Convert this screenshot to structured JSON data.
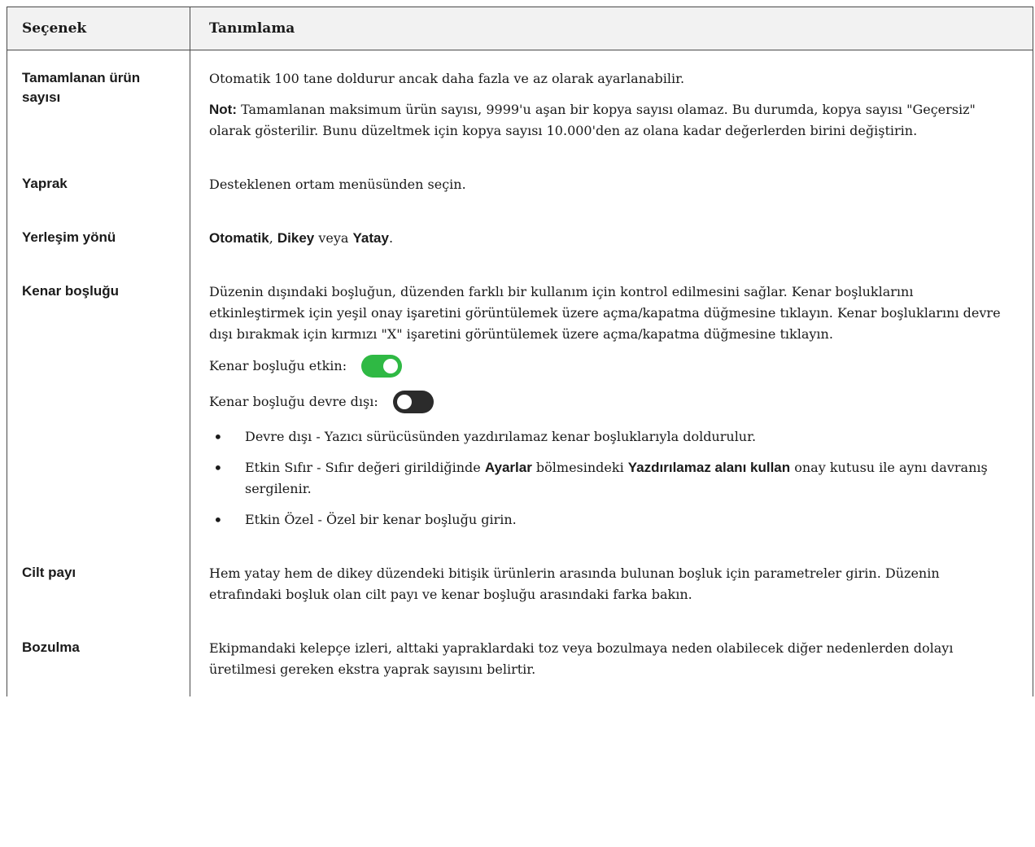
{
  "header": {
    "col1": "Seçenek",
    "col2": "Tanımlama"
  },
  "colors": {
    "toggle_on": "#2fb944",
    "toggle_off": "#2b2b2b",
    "header_bg": "#f2f2f2"
  },
  "rows": {
    "completed": {
      "label": "Tamamlanan ürün sayısı",
      "text": "Otomatik 100 tane doldurur ancak daha fazla ve az olarak ayarlanabilir.",
      "note_label": "Not:",
      "note_text": " Tamamlanan maksimum ürün sayısı, 9999'u aşan bir kopya sayısı olamaz. Bu durumda, kopya sayısı \"Geçersiz\" olarak gösterilir. Bunu düzeltmek için kopya sayısı 10.000'den az olana kadar değerlerden birini değiştirin."
    },
    "sheet": {
      "label": "Yaprak",
      "text": "Desteklenen ortam menüsünden seçin."
    },
    "orientation": {
      "label": "Yerleşim yönü",
      "opt1": "Otomatik",
      "sep1": ", ",
      "opt2": "Dikey",
      "sep2": " veya ",
      "opt3": "Yatay",
      "end": "."
    },
    "margin": {
      "label": "Kenar boşluğu",
      "text": "Düzenin dışındaki boşluğun, düzenden farklı bir kullanım için kontrol edilmesini sağlar. Kenar boşluklarını etkinleştirmek için yeşil onay işaretini görüntülemek üzere açma/kapatma düğmesine tıklayın. Kenar boşluklarını devre dışı bırakmak için kırmızı \"X\" işaretini görüntülemek üzere açma/kapatma düğmesine tıklayın.",
      "enabled_label": "Kenar boşluğu etkin:",
      "disabled_label": "Kenar boşluğu devre dışı:",
      "bullet1": "Devre dışı - Yazıcı sürücüsünden yazdırılamaz kenar boşluklarıyla doldurulur.",
      "bullet2_a": "Etkin Sıfır - Sıfır değeri girildiğinde ",
      "bullet2_b": "Ayarlar",
      "bullet2_c": " bölmesindeki ",
      "bullet2_d": "Yazdırılamaz alanı kullan",
      "bullet2_e": " onay kutusu ile aynı davranış sergilenir.",
      "bullet3": "Etkin Özel - Özel bir kenar boşluğu girin."
    },
    "gutter": {
      "label": "Cilt payı",
      "text": "Hem yatay hem de dikey düzendeki bitişik ürünlerin arasında bulunan boşluk için parametreler girin. Düzenin etrafındaki boşluk olan cilt payı ve kenar boşluğu arasındaki farka bakın."
    },
    "spoilage": {
      "label": "Bozulma",
      "text": "Ekipmandaki kelepçe izleri, alttaki yapraklardaki toz veya bozulmaya neden olabilecek diğer nedenlerden dolayı üretilmesi gereken ekstra yaprak sayısını belirtir."
    }
  }
}
